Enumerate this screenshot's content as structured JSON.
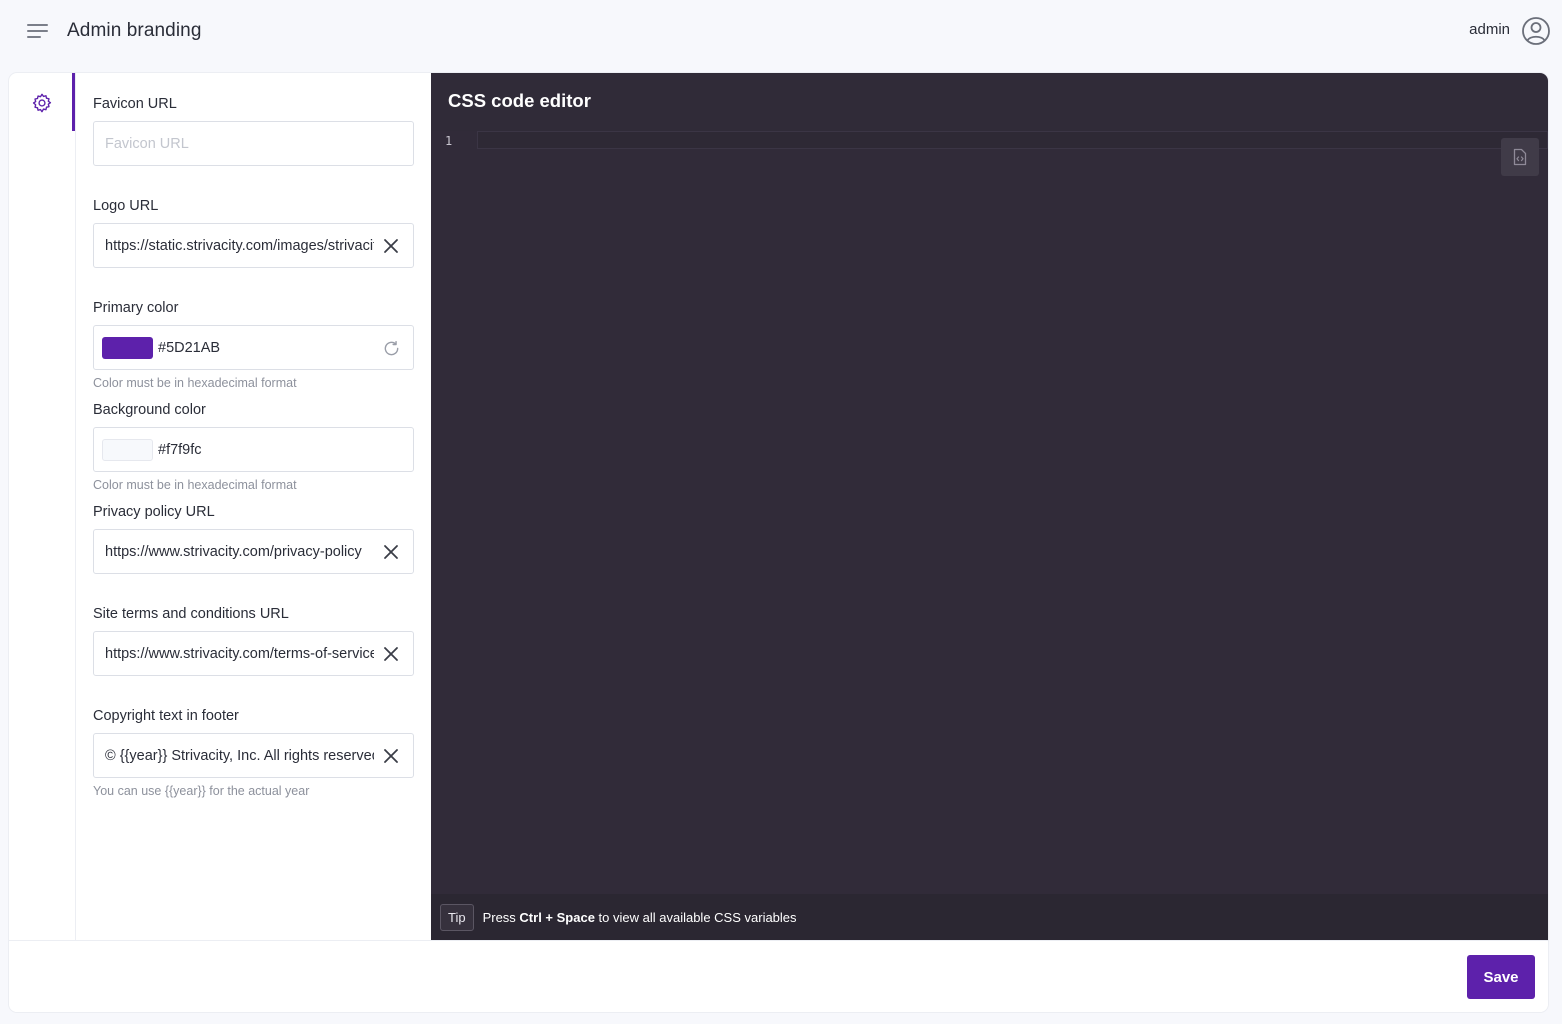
{
  "header": {
    "title": "Admin branding",
    "user_name": "admin"
  },
  "form": {
    "favicon": {
      "label": "Favicon URL",
      "placeholder": "Favicon URL",
      "value": ""
    },
    "logo": {
      "label": "Logo URL",
      "value": "https://static.strivacity.com/images/strivacity-logo.svg"
    },
    "primary_color": {
      "label": "Primary color",
      "value": "#5D21AB",
      "hint": "Color must be in hexadecimal format"
    },
    "background_color": {
      "label": "Background color",
      "value": "#f7f9fc",
      "hint": "Color must be in hexadecimal format"
    },
    "privacy": {
      "label": "Privacy policy URL",
      "value": "https://www.strivacity.com/privacy-policy"
    },
    "terms": {
      "label": "Site terms and conditions URL",
      "value": "https://www.strivacity.com/terms-of-service"
    },
    "copyright": {
      "label": "Copyright text in footer",
      "value": "© {{year}} Strivacity, Inc. All rights reserved.",
      "hint": "You can use {{year}} for the actual year"
    }
  },
  "editor": {
    "title": "CSS code editor",
    "line_number": "1",
    "tip_badge": "Tip",
    "tip_pre": "Press ",
    "tip_keys": "Ctrl + Space",
    "tip_post": " to view all available CSS variables"
  },
  "footer": {
    "save_label": "Save"
  },
  "colors": {
    "accent": "#5D21AB",
    "editor_bg": "#302b38",
    "page_bg": "#f7f8fc"
  },
  "icons": [
    "menu-icon",
    "user-icon",
    "gear-icon",
    "clear-icon",
    "reset-icon",
    "format-code-icon"
  ]
}
